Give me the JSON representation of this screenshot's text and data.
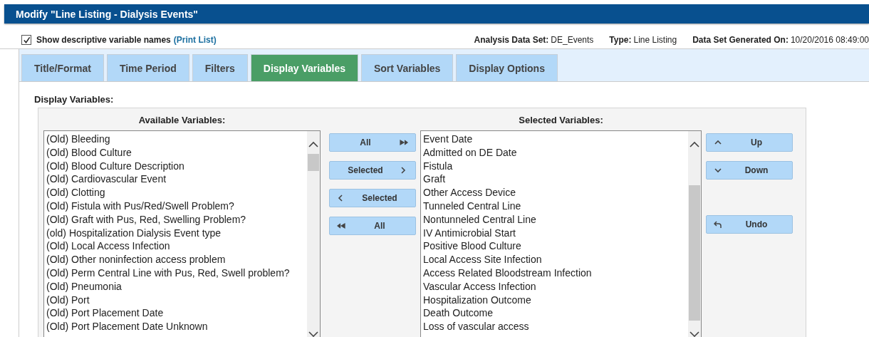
{
  "window": {
    "title": "Modify \"Line Listing - Dialysis Events\""
  },
  "options": {
    "show_descriptive": {
      "label": "Show descriptive variable names",
      "checked": true
    },
    "print_link": "(Print List)"
  },
  "info": [
    {
      "label": "Analysis Data Set:",
      "value": "DE_Events"
    },
    {
      "label": "Type:",
      "value": "Line Listing"
    },
    {
      "label": "Data Set Generated On:",
      "value": "10/20/2016 08:49:00"
    }
  ],
  "tabs": [
    {
      "label": "Title/Format",
      "selected": false
    },
    {
      "label": "Time Period",
      "selected": false
    },
    {
      "label": "Filters",
      "selected": false
    },
    {
      "label": "Display Variables",
      "selected": true
    },
    {
      "label": "Sort Variables",
      "selected": false
    },
    {
      "label": "Display Options",
      "selected": false
    }
  ],
  "section_title": "Display Variables:",
  "available": {
    "heading": "Available Variables:",
    "items": [
      "(Old) Bleeding",
      "(Old) Blood Culture",
      "(Old) Blood Culture Description",
      "(Old) Cardiovascular Event",
      "(Old) Clotting",
      "(Old) Fistula with Pus/Red/Swell Problem?",
      "(Old) Graft with Pus, Red, Swelling Problem?",
      "(old) Hospitalization Dialysis Event type",
      "(Old) Local Access Infection",
      "(Old) Other noninfection access problem",
      "(Old) Perm Central Line with Pus, Red, Swell problem?",
      "(Old) Pneumonia",
      "(Old) Port",
      "(Old) Port Placement Date",
      "(Old) Port Placement Date Unknown"
    ]
  },
  "move_buttons": [
    {
      "label": "All",
      "kind": "add-all"
    },
    {
      "label": "Selected",
      "kind": "add"
    },
    {
      "label": "Selected",
      "kind": "remove"
    },
    {
      "label": "All",
      "kind": "remove-all"
    }
  ],
  "selected": {
    "heading": "Selected Variables:",
    "items": [
      "Event Date",
      "Admitted on DE Date",
      "Fistula",
      "Graft",
      "Other Access Device",
      "Tunneled Central Line",
      "Nontunneled Central Line",
      "IV Antimicrobial Start",
      "Positive Blood Culture",
      "Local Access Site Infection",
      "Access Related Bloodstream Infection",
      "Vascular Access Infection",
      "Hospitalization Outcome",
      "Death Outcome",
      "Loss of vascular access"
    ]
  },
  "order_buttons": [
    {
      "label": "Up",
      "kind": "up"
    },
    {
      "label": "Down",
      "kind": "down"
    },
    {
      "label": "Undo",
      "kind": "undo"
    }
  ]
}
